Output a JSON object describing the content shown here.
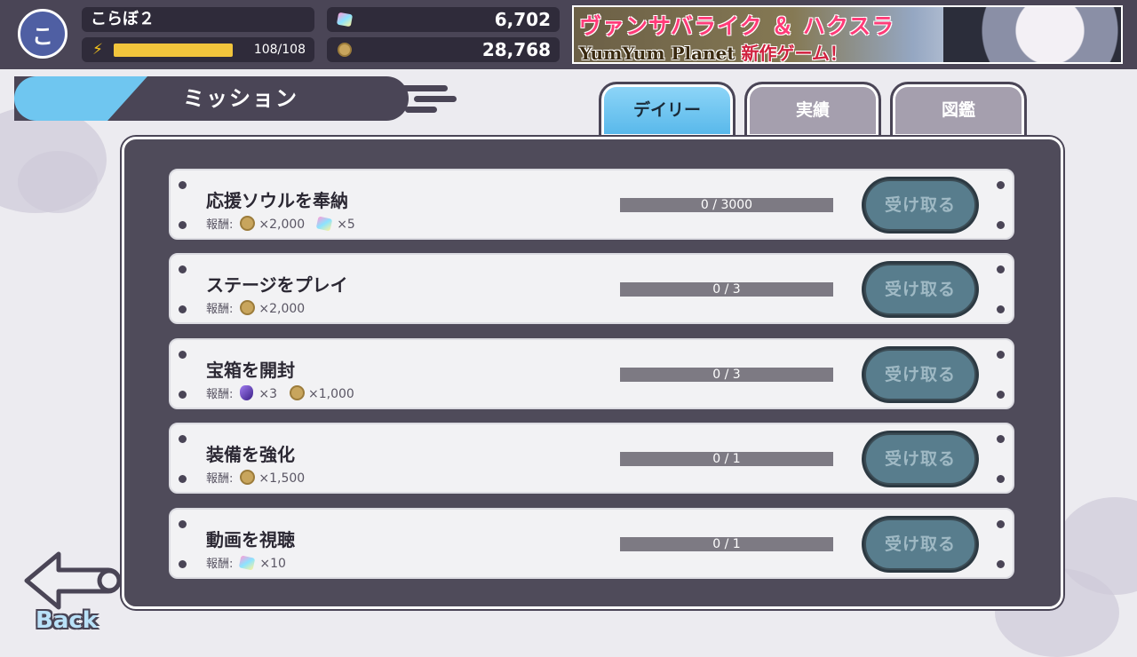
{
  "player": {
    "avatar_initial": "こ",
    "name": "こらぼ２",
    "stamina_text": "108/108",
    "stamina_fraction": 1.0
  },
  "currency": {
    "gems": "6,702",
    "coins": "28,768"
  },
  "banner": {
    "line1": "ヴァンサバライク ＆ ハクスラ",
    "line2_a": "YumYum Planet",
    "line2_b": "新作ゲーム！"
  },
  "screen": {
    "title": "ミッション"
  },
  "tabs": [
    {
      "label": "デイリー",
      "active": true
    },
    {
      "label": "実績",
      "active": false
    },
    {
      "label": "図鑑",
      "active": false
    }
  ],
  "reward_label": "報酬:",
  "claim_label": "受け取る",
  "missions": [
    {
      "title": "応援ソウルを奉納",
      "progress_text": "0 / 3000",
      "progress_fraction": 0,
      "rewards": [
        {
          "icon": "coin-icon",
          "amount": "×2,000"
        },
        {
          "icon": "gem-icon",
          "amount": "×5"
        }
      ]
    },
    {
      "title": "ステージをプレイ",
      "progress_text": "0 / 3",
      "progress_fraction": 0,
      "rewards": [
        {
          "icon": "coin-icon",
          "amount": "×2,000"
        }
      ]
    },
    {
      "title": "宝箱を開封",
      "progress_text": "0 / 3",
      "progress_fraction": 0,
      "rewards": [
        {
          "icon": "stone-icon",
          "amount": "×3"
        },
        {
          "icon": "coin-icon",
          "amount": "×1,000"
        }
      ]
    },
    {
      "title": "装備を強化",
      "progress_text": "0 / 1",
      "progress_fraction": 0,
      "rewards": [
        {
          "icon": "coin-icon",
          "amount": "×1,500"
        }
      ]
    },
    {
      "title": "動画を視聴",
      "progress_text": "0 / 1",
      "progress_fraction": 0,
      "rewards": [
        {
          "icon": "gem-icon",
          "amount": "×10"
        }
      ]
    }
  ],
  "back_label": "Back",
  "colors": {
    "accent_blue": "#6fc6f0",
    "dark": "#4a4556",
    "gold": "#f2c53c",
    "claim_disabled": "#587d8d"
  }
}
